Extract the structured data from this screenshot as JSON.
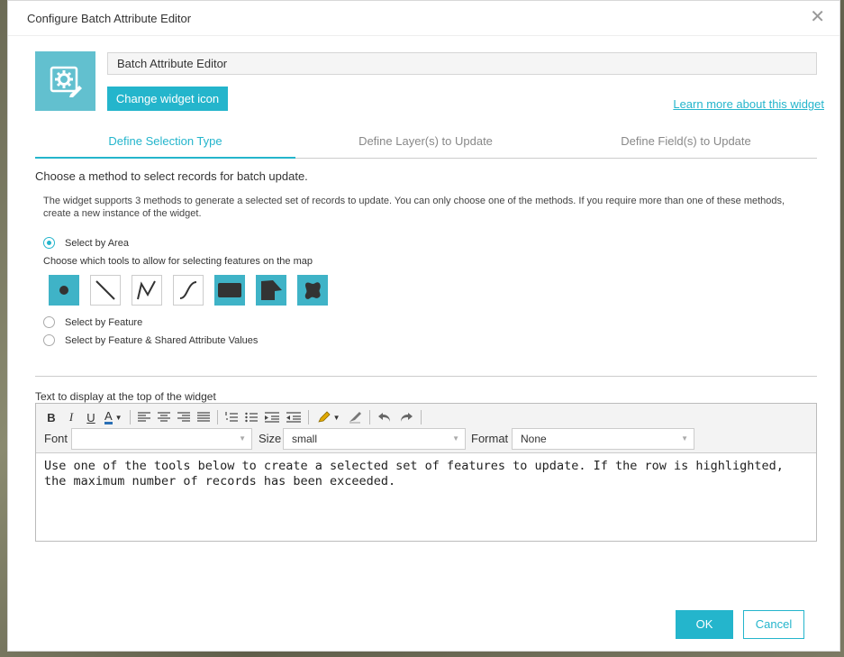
{
  "dialog": {
    "title": "Configure Batch Attribute Editor",
    "close_icon": "close-icon"
  },
  "header": {
    "widget_icon": "gear-edit-icon",
    "widget_name": "Batch Attribute Editor",
    "change_icon_label": "Change widget icon",
    "learn_more_label": "Learn more about this widget"
  },
  "tabs": [
    {
      "label": "Define Selection Type",
      "active": true
    },
    {
      "label": "Define Layer(s) to Update",
      "active": false
    },
    {
      "label": "Define Field(s) to Update",
      "active": false
    }
  ],
  "selection": {
    "heading": "Choose a method to select records for batch update.",
    "description": "The widget supports 3 methods to generate a selected set of records to update. You can only choose one of the methods. If you require more than one of these methods, create a new instance of the widget.",
    "options": [
      {
        "label": "Select by Area",
        "checked": true
      },
      {
        "label": "Select by Feature",
        "checked": false
      },
      {
        "label": "Select by Feature & Shared Attribute Values",
        "checked": false
      }
    ],
    "tools_label": "Choose which tools to allow for selecting features on the map",
    "tools": [
      {
        "icon": "point-icon",
        "enabled": true
      },
      {
        "icon": "line-icon",
        "enabled": false
      },
      {
        "icon": "polyline-icon",
        "enabled": false
      },
      {
        "icon": "freehand-polyline-icon",
        "enabled": false
      },
      {
        "icon": "rectangle-icon",
        "enabled": true
      },
      {
        "icon": "polygon-icon",
        "enabled": true
      },
      {
        "icon": "freehand-polygon-icon",
        "enabled": true
      }
    ]
  },
  "editor": {
    "label": "Text to display at the top of the widget",
    "font_label": "Font",
    "font_value": "",
    "size_label": "Size",
    "size_value": "small",
    "format_label": "Format",
    "format_value": "None",
    "content": "Use one of the tools below to create a selected set of features to update. If the row is highlighted, the maximum number of records has been exceeded."
  },
  "footer": {
    "ok_label": "OK",
    "cancel_label": "Cancel"
  },
  "colors": {
    "accent": "#24b5cc",
    "icon_bg": "#62c0cf",
    "tool_on": "#3fb3c7"
  }
}
